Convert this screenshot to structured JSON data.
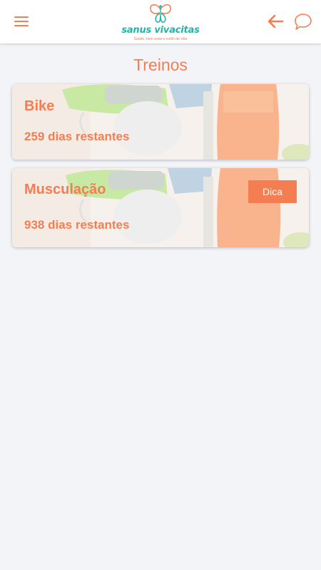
{
  "header": {
    "logo_name": "sanus vivacitas",
    "logo_tagline": "Saúde, bem-estar e estilo de vida"
  },
  "page": {
    "title": "Treinos"
  },
  "trainings": [
    {
      "title": "Bike",
      "remaining": "259 dias restantes"
    },
    {
      "title": "Musculação",
      "remaining": "938 dias restantes",
      "tip_label": "Dica"
    }
  ],
  "colors": {
    "accent": "#f47d51",
    "brand_teal": "#1fb5a8",
    "background": "#f3f4f8"
  }
}
